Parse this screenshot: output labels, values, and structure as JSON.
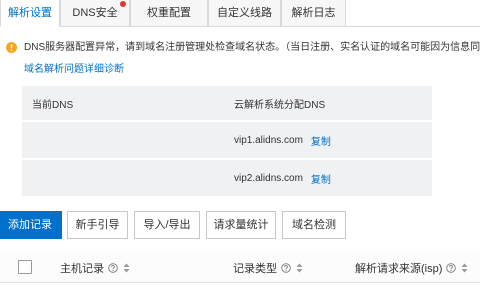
{
  "tabs": [
    {
      "label": "解析设置",
      "active": true,
      "badge": false
    },
    {
      "label": "DNS安全",
      "active": false,
      "badge": true
    },
    {
      "label": "权重配置",
      "active": false,
      "badge": false
    },
    {
      "label": "自定义线路",
      "active": false,
      "badge": false
    },
    {
      "label": "解析日志",
      "active": false,
      "badge": false
    }
  ],
  "notice": {
    "icon": "warning-icon",
    "text": "DNS服务器配置异常，请到域名注册管理处检查域名状态。（当日注册、实名认证的域名可能因为信息同",
    "link": "域名解析问题详细诊断"
  },
  "dns_table": {
    "headers": {
      "current": "当前DNS",
      "assigned": "云解析系统分配DNS"
    },
    "rows": [
      {
        "current": "",
        "assigned": "vip1.alidns.com",
        "action": "复制"
      },
      {
        "current": "",
        "assigned": "vip2.alidns.com",
        "action": "复制"
      }
    ]
  },
  "toolbar": {
    "buttons": [
      {
        "label": "添加记录",
        "primary": true
      },
      {
        "label": "新手引导",
        "primary": false
      },
      {
        "label": "导入/导出",
        "primary": false
      },
      {
        "label": "请求量统计",
        "primary": false
      },
      {
        "label": "域名检测",
        "primary": false
      }
    ]
  },
  "records_table": {
    "select_all_icon": "checkbox",
    "columns": [
      {
        "label": "主机记录",
        "help_icon": "help-icon",
        "sort_icon": "sort-icon"
      },
      {
        "label": "记录类型",
        "help_icon": "help-icon",
        "sort_icon": "sort-icon"
      },
      {
        "label": "解析请求来源(isp)",
        "help_icon": "help-icon",
        "sort_icon": "sort-icon"
      }
    ]
  },
  "colors": {
    "accent": "#0070cc",
    "warning": "#f5a623",
    "badge": "#e5352b",
    "panel_bg": "#f0f1f3"
  }
}
